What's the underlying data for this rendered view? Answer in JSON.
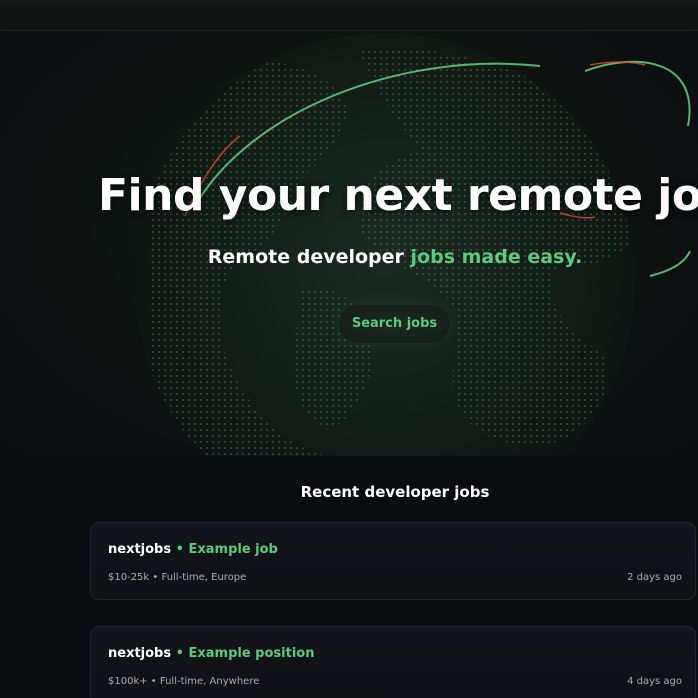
{
  "hero": {
    "headline": "Find your next remote job",
    "subline_plain": "Remote developer ",
    "subline_accent": "jobs made easy.",
    "search_button": "Search jobs"
  },
  "colors": {
    "accent": "#5fc77f",
    "background": "#0b0c10",
    "card": "#13151a"
  },
  "jobs_section": {
    "title": "Recent developer jobs",
    "jobs": [
      {
        "company": "nextjobs",
        "separator": " • ",
        "role": "Example job",
        "salary": "$10-25k",
        "dot": " • ",
        "details": "Full-time, Europe",
        "age": "2 days ago"
      },
      {
        "company": "nextjobs",
        "separator": " • ",
        "role": "Example position",
        "salary": "$100k+",
        "dot": " • ",
        "details": "Full-time, Anywhere",
        "age": "4 days ago"
      }
    ]
  }
}
